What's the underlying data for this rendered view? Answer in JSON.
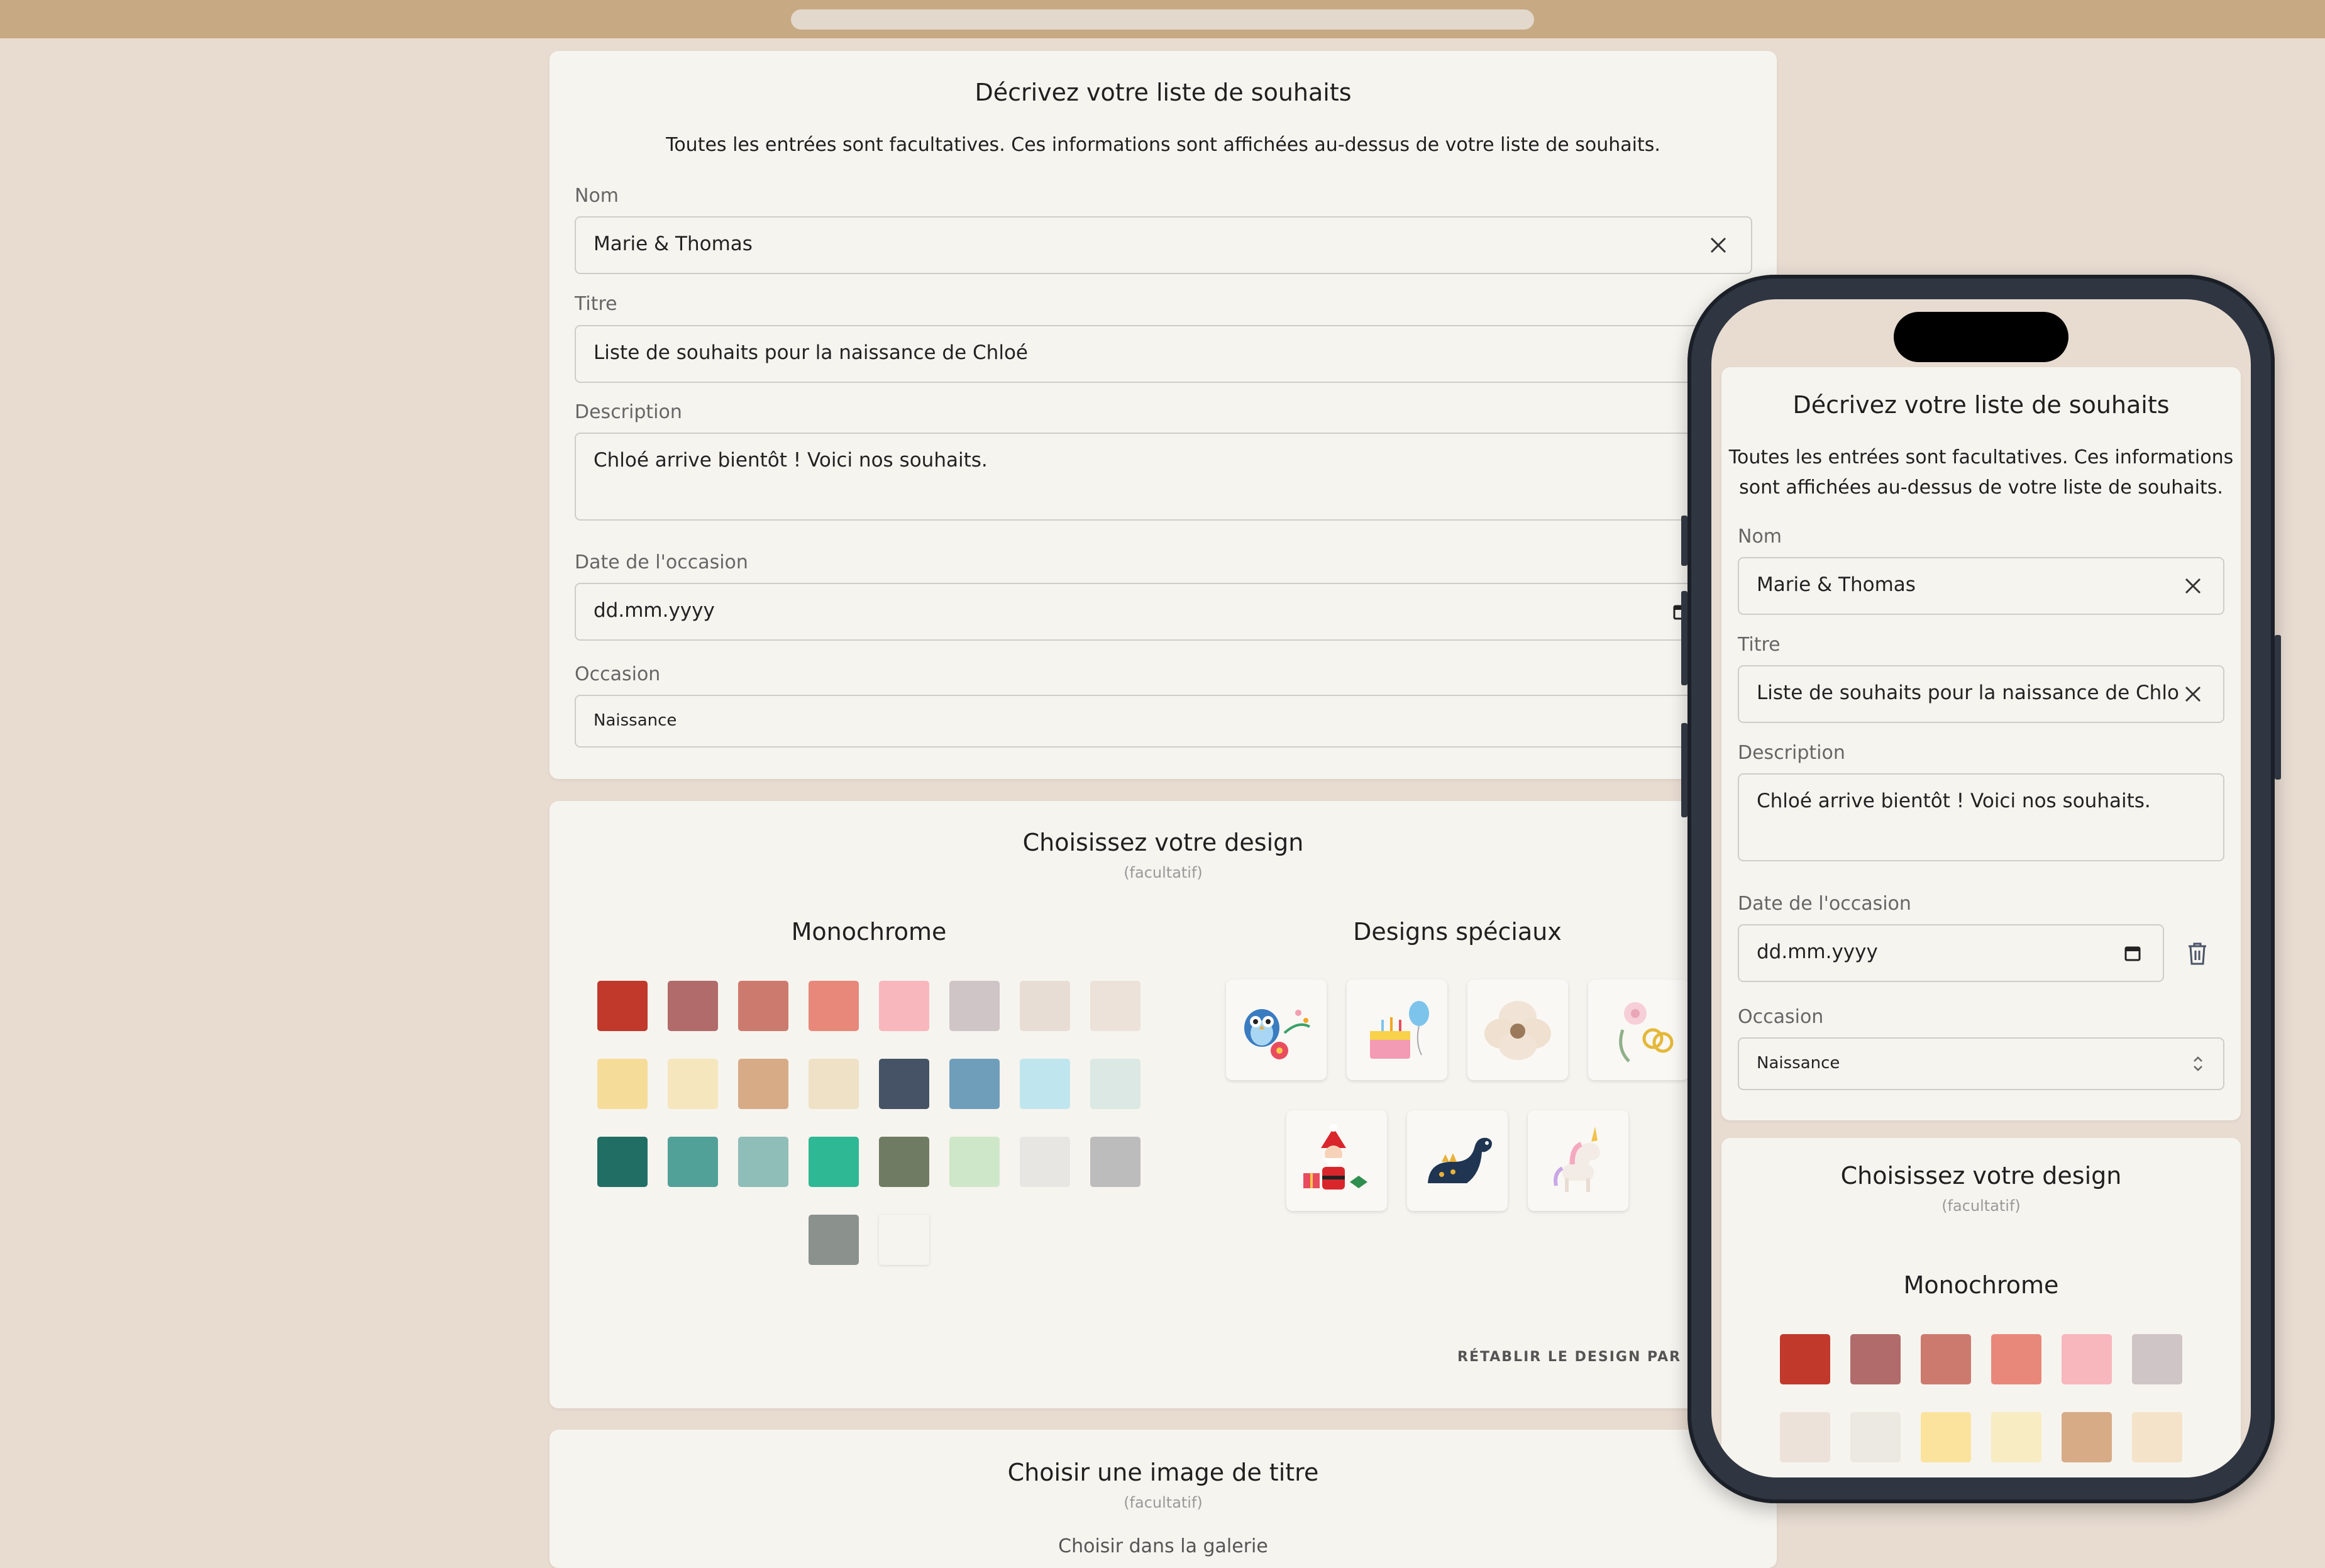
{
  "main": {
    "describe": {
      "title": "Décrivez votre liste de souhaits",
      "intro": "Toutes les entrées sont facultatives. Ces informations sont affichées au-dessus de votre liste de souhaits.",
      "name_label": "Nom",
      "name_value": "Marie & Thomas",
      "title_label": "Titre",
      "title_value": "Liste de souhaits pour la naissance de Chloé",
      "desc_label": "Description",
      "desc_value": "Chloé arrive bientôt ! Voici nos souhaits.",
      "date_label": "Date de l'occasion",
      "date_placeholder": "dd.mm.yyyy",
      "occasion_label": "Occasion",
      "occasion_value": "Naissance"
    },
    "design": {
      "title": "Choisissez votre design",
      "optional": "(facultatif)",
      "mono_title": "Monochrome",
      "special_title": "Designs spéciaux",
      "reset_label": "RÉTABLIR LE DESIGN PAR DÉ",
      "swatches": [
        "#c0392b",
        "#b06b6a",
        "#cd7a6e",
        "#e8887a",
        "#f8b7bd",
        "#cfc4c6",
        "#e8ddd4",
        "#ece2da",
        "#f5dc98",
        "#f5e6bd",
        "#d6ab86",
        "#efe1c5",
        "#465366",
        "#6f9ebb",
        "#bfe6ee",
        "#dbe8e4",
        "#216e64",
        "#51a199",
        "#8fbdb7",
        "#2eb894",
        "#6f7c63",
        "#cfe7c9",
        "#e7e6e2",
        "#bcbcbc",
        "#8b918d",
        "#f6f4ef"
      ],
      "special_icons": [
        "owl-flowers-icon",
        "birthday-cake-icon",
        "flower-icon",
        "rings-icon",
        "santa-icon",
        "dinosaur-icon",
        "unicorn-icon"
      ]
    },
    "header_image": {
      "title": "Choisir une image de titre",
      "optional": "(facultatif)",
      "gallery_label": "Choisir dans la galerie"
    }
  },
  "phone": {
    "describe": {
      "title": "Décrivez votre liste de souhaits",
      "intro_line1": "Toutes les entrées sont facultatives. Ces informations",
      "intro_line2": "sont affichées au-dessus de votre liste de souhaits.",
      "name_label": "Nom",
      "name_value": "Marie & Thomas",
      "title_label": "Titre",
      "title_value": "Liste de souhaits pour la naissance de Chloé",
      "desc_label": "Description",
      "desc_value": "Chloé arrive bientôt ! Voici nos souhaits.",
      "date_label": "Date de l'occasion",
      "date_placeholder": "dd.mm.yyyy",
      "occasion_label": "Occasion",
      "occasion_value": "Naissance"
    },
    "design": {
      "title": "Choisissez votre design",
      "optional": "(facultatif)",
      "mono_title": "Monochrome",
      "swatches": [
        "#c0392b",
        "#b06b6a",
        "#cd7a6e",
        "#e8887a",
        "#f8b7bd",
        "#cfc4c6",
        "#ece2da",
        "#ece8e2",
        "#fbe39e",
        "#f8ecc2",
        "#d6ab86",
        "#f4e3c8"
      ]
    }
  }
}
